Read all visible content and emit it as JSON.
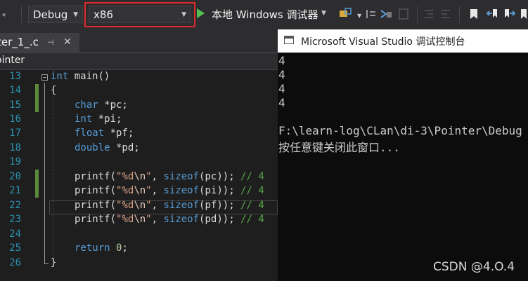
{
  "toolbar": {
    "config_value": "Debug",
    "platform_value": "x86",
    "run_label": "本地 Windows 调试器",
    "icons": [
      "nav-back-icon",
      "find-in-files-icon",
      "show-threads-icon",
      "step-icon",
      "indent-icon",
      "bookmark-icon",
      "bookmark-prev-icon",
      "bookmark-next-icon",
      "bookmark-clear-icon"
    ]
  },
  "editor": {
    "tab_label": "ter_1_.c",
    "nav_scope": "ointer",
    "lines": [
      {
        "n": "13"
      },
      {
        "n": "14"
      },
      {
        "n": "15"
      },
      {
        "n": "16"
      },
      {
        "n": "17"
      },
      {
        "n": "18"
      },
      {
        "n": "19"
      },
      {
        "n": "20"
      },
      {
        "n": "21"
      },
      {
        "n": "22"
      },
      {
        "n": "23"
      },
      {
        "n": "24"
      },
      {
        "n": "25"
      },
      {
        "n": "26"
      }
    ],
    "code": {
      "l13_kw": "int",
      "l13_rest": " main()",
      "l14": "{",
      "l15_kw": "char",
      "l15_rest": " *pc;",
      "l16_kw": "int",
      "l16_rest": " *pi;",
      "l17_kw": "float",
      "l17_rest": " *pf;",
      "l18_kw": "double",
      "l18_rest": " *pd;",
      "printf": "printf(",
      "fmt_q": "\"%d",
      "fmt_esc": "\\n",
      "fmt_end": "\"",
      "sizeof": "sizeof",
      "arg_pc": "(pc)); ",
      "arg_pi": "(pi)); ",
      "arg_pf": "(pf)); ",
      "arg_pd": "(pd)); ",
      "comment": "// 4",
      "comma": ", ",
      "ret_kw": "return",
      "ret_val": "0",
      "ret_end": ";",
      "l26": "}"
    }
  },
  "console": {
    "title": "Microsoft Visual Studio 调试控制台",
    "output": [
      "4",
      "4",
      "4",
      "4",
      "",
      "F:\\learn-log\\CLan\\di-3\\Pointer\\Debug",
      "按任意键关闭此窗口..."
    ]
  },
  "watermark": "CSDN @4.O.4"
}
